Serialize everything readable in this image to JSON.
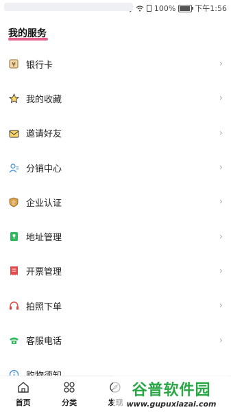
{
  "status_bar": {
    "battery": "100%",
    "time": "下午1:56"
  },
  "section": {
    "title": "我的服务"
  },
  "menu": {
    "items": [
      {
        "label": "银行卡"
      },
      {
        "label": "我的收藏"
      },
      {
        "label": "邀请好友"
      },
      {
        "label": "分销中心"
      },
      {
        "label": "企业认证"
      },
      {
        "label": "地址管理"
      },
      {
        "label": "开票管理"
      },
      {
        "label": "拍照下单"
      },
      {
        "label": "客服电话"
      },
      {
        "label": "购物须知"
      }
    ],
    "chevron": "›"
  },
  "tabbar": {
    "tabs": [
      {
        "label": "首页"
      },
      {
        "label": "分类"
      },
      {
        "label": "发现"
      }
    ]
  },
  "watermark": {
    "main": "谷普软件园",
    "sub": "www.gupuxiazai.com"
  }
}
